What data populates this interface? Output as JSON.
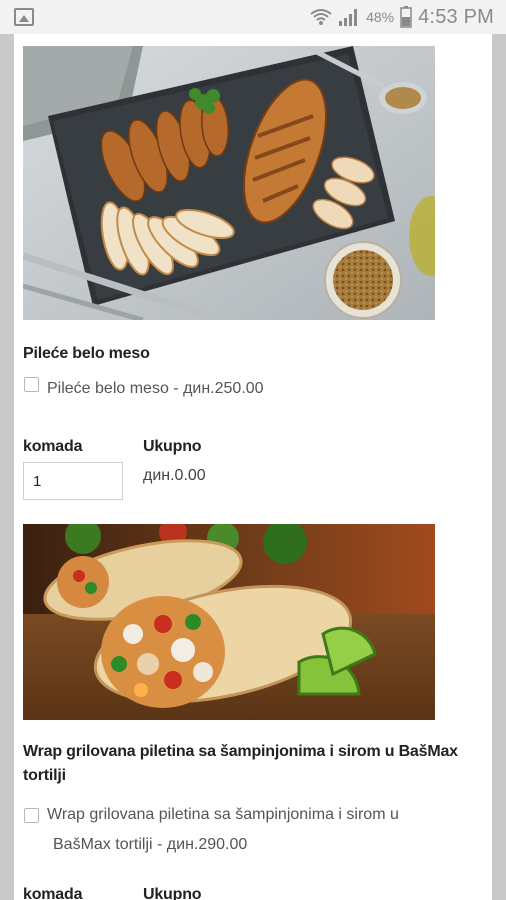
{
  "status_bar": {
    "battery": "48%",
    "time": "4:53 PM",
    "icons": [
      "image-icon",
      "wifi-icon",
      "signal-icon",
      "battery-icon"
    ]
  },
  "products": [
    {
      "title": "Pileće belo meso",
      "option_label": "Pileće belo meso - дин.250.00",
      "qty_label": "komada",
      "qty_value": "1",
      "total_label": "Ukupno",
      "total_value": "дин.0.00",
      "image": "grilled-chicken-breast-photo"
    },
    {
      "title": "Wrap grilovana piletina sa šampinjonima i sirom u BašMax tortilji",
      "option_label_line1": "Wrap grilovana piletina sa šampinjonima i sirom u",
      "option_label_line2": "BašMax tortilji - дин.290.00",
      "qty_label": "komada",
      "total_label": "Ukupno",
      "image": "chicken-wrap-photo"
    }
  ],
  "colors": {
    "background": "#c9c9c9",
    "card": "#ffffff",
    "status_bar": "#f2f2f2"
  }
}
